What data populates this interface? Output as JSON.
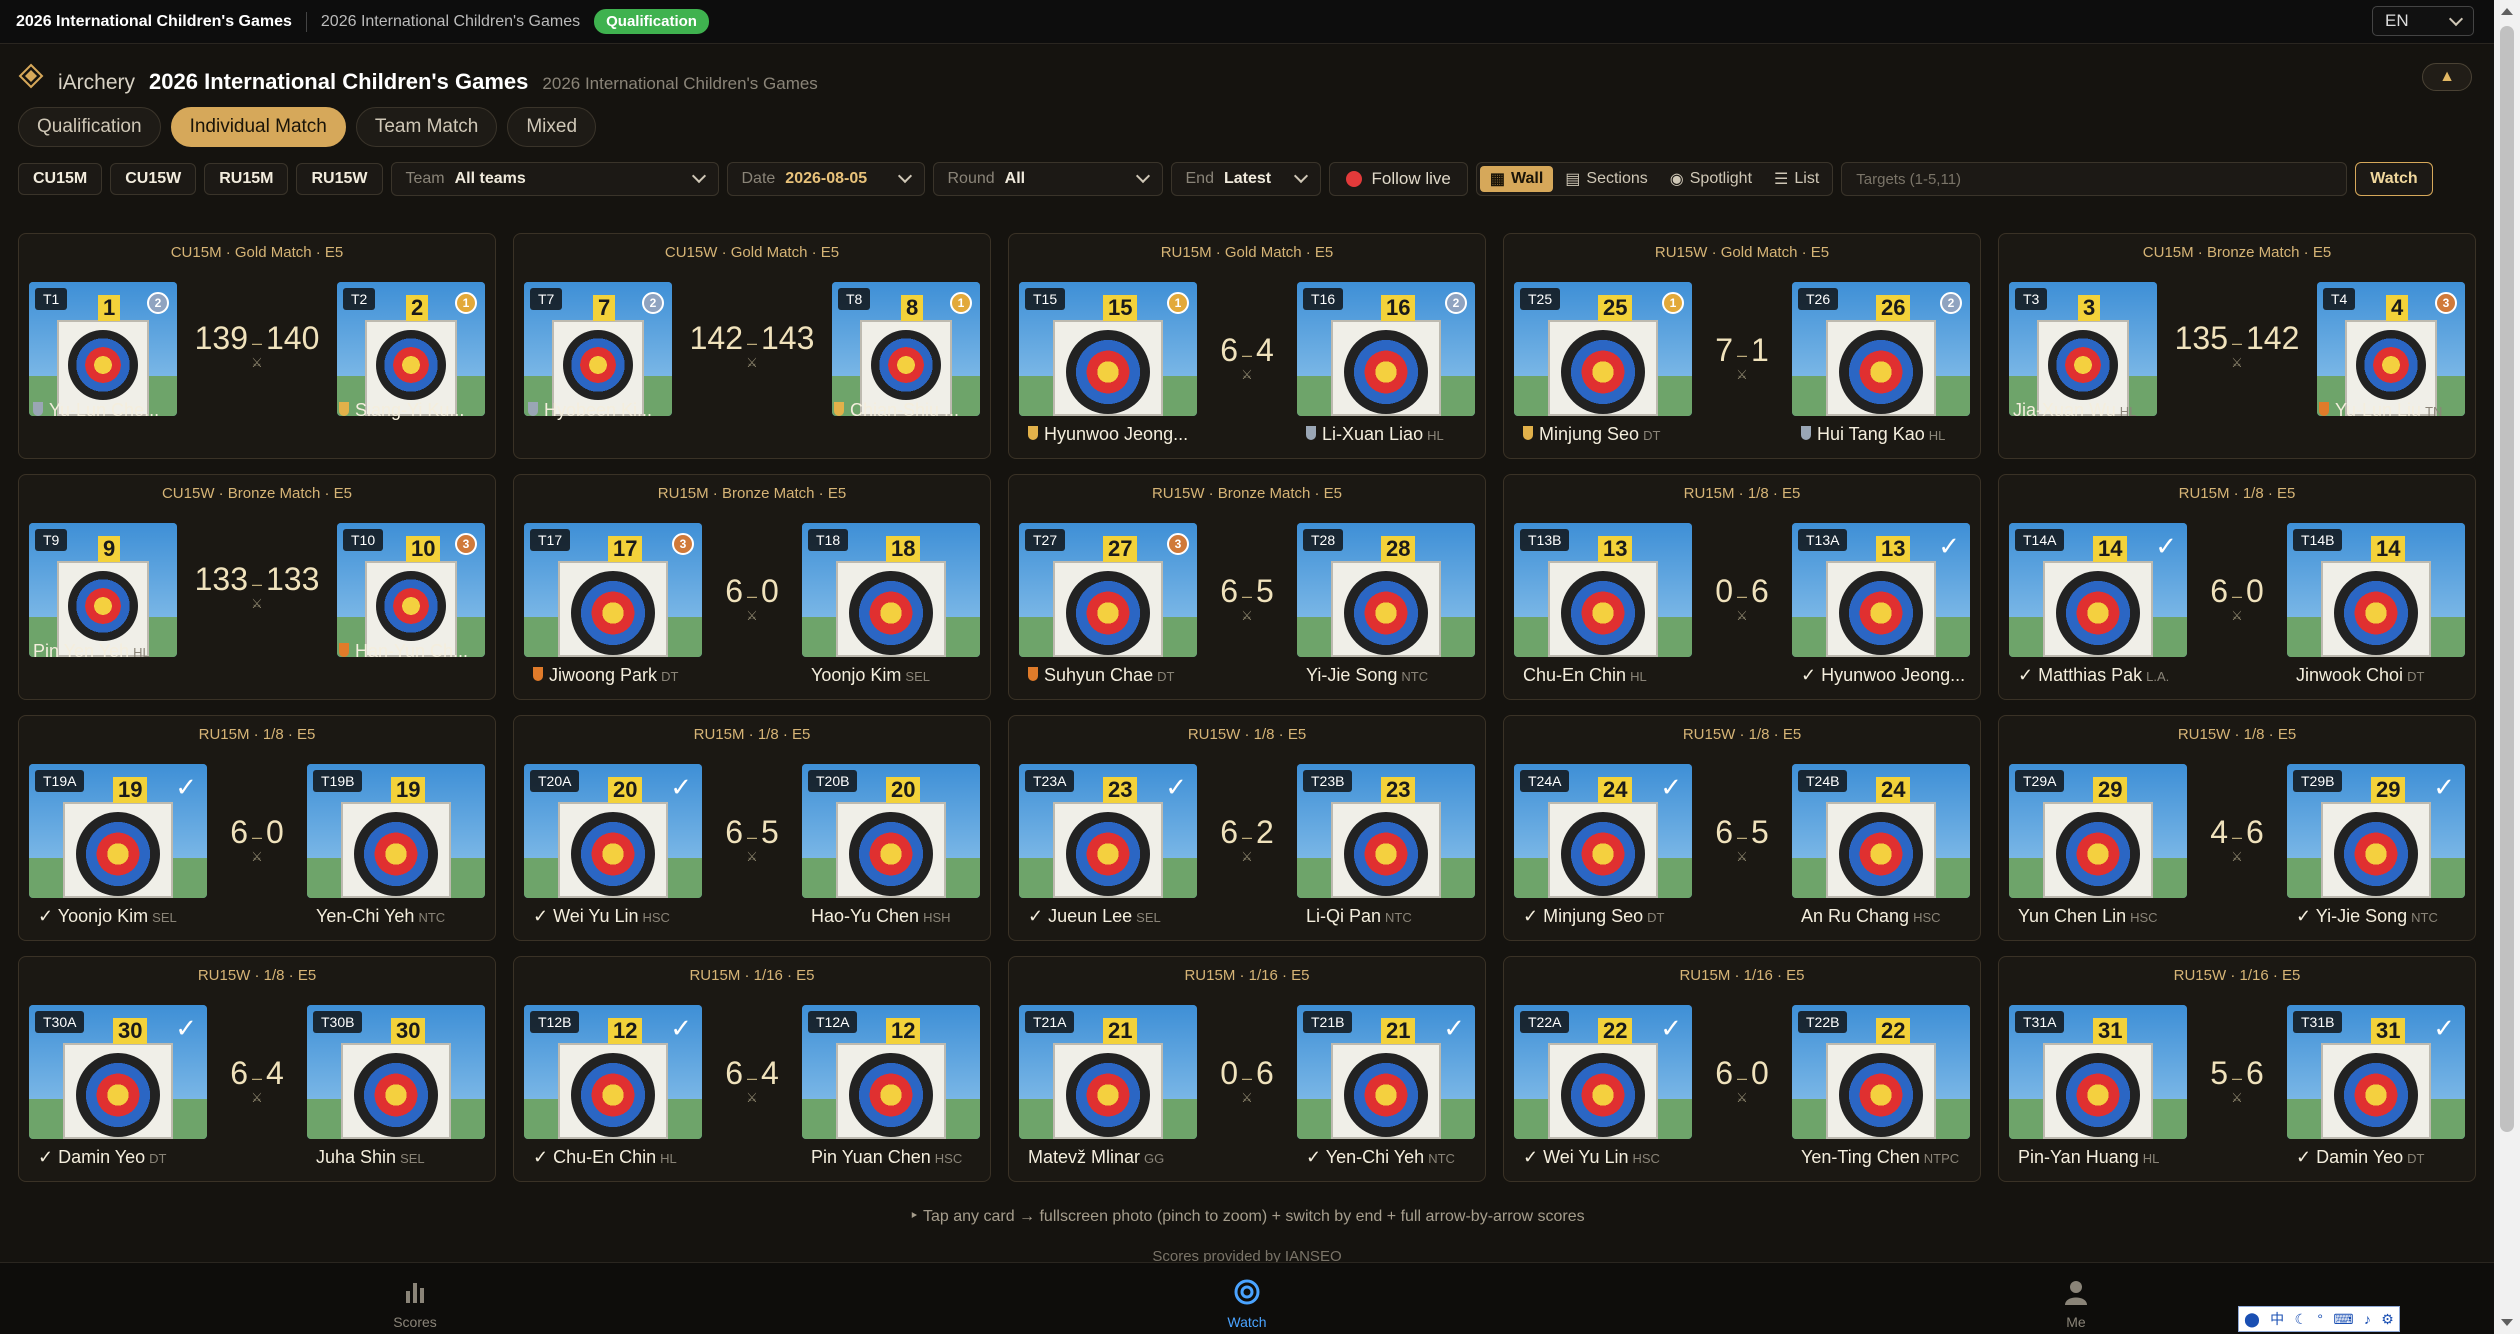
{
  "topbar": {
    "title": "2026 International Children's Games",
    "subtitle": "2026 International Children's Games",
    "badge": "Qualification",
    "language": "EN"
  },
  "header": {
    "app_name": "iArchery",
    "event": "2026 International Children's Games",
    "event_sub": "2026 International Children's Games",
    "collapse_icon": "▲"
  },
  "tabs": [
    "Qualification",
    "Individual Match",
    "Team Match",
    "Mixed"
  ],
  "active_tab": "Individual Match",
  "filters": {
    "divisions": [
      "CU15M",
      "CU15W",
      "RU15M",
      "RU15W"
    ],
    "team_label": "Team",
    "team_value": "All teams",
    "date_label": "Date",
    "date_value": "2026-08-05",
    "round_label": "Round",
    "round_value": "All",
    "end_label": "End",
    "end_value": "Latest",
    "follow_live": "Follow live",
    "views": [
      "Wall",
      "Sections",
      "Spotlight",
      "List"
    ],
    "active_view": "Wall",
    "targets_placeholder": "Targets (1-5,11)",
    "watch": "Watch"
  },
  "cards": [
    {
      "caption": "CU15M · Gold Match · E5",
      "a": {
        "tgt": "T1",
        "num": "1",
        "name": "Yu-Lun Che...",
        "club": "",
        "medal": "silver",
        "check": false
      },
      "b": {
        "tgt": "T2",
        "num": "2",
        "name": "Siang-Yi Ku...",
        "club": "",
        "medal": "gold",
        "check": false
      },
      "score_a": "139",
      "score_b": "140",
      "compound": true
    },
    {
      "caption": "CU15W · Gold Match · E5",
      "a": {
        "tgt": "T7",
        "num": "7",
        "name": "Hyobeen Ki...",
        "club": "",
        "medal": "silver",
        "check": false
      },
      "b": {
        "tgt": "T8",
        "num": "8",
        "name": "Chian-Shiu ...",
        "club": "",
        "medal": "gold",
        "check": false
      },
      "score_a": "142",
      "score_b": "143",
      "compound": true
    },
    {
      "caption": "RU15M · Gold Match · E5",
      "a": {
        "tgt": "T15",
        "num": "15",
        "name": "Hyunwoo Jeong...",
        "club": "",
        "medal": "gold",
        "check": false
      },
      "b": {
        "tgt": "T16",
        "num": "16",
        "name": "Li-Xuan Liao",
        "club": "HL",
        "medal": "silver",
        "check": false
      },
      "score_a": "6",
      "score_b": "4",
      "compound": false
    },
    {
      "caption": "RU15W · Gold Match · E5",
      "a": {
        "tgt": "T25",
        "num": "25",
        "name": "Minjung Seo",
        "club": "DT",
        "medal": "gold",
        "check": false
      },
      "b": {
        "tgt": "T26",
        "num": "26",
        "name": "Hui Tang Kao",
        "club": "HL",
        "medal": "silver",
        "check": false
      },
      "score_a": "7",
      "score_b": "1",
      "compound": false
    },
    {
      "caption": "CU15M · Bronze Match · E5",
      "a": {
        "tgt": "T3",
        "num": "3",
        "name": "Jia-Xuan Wu",
        "club": "HL",
        "medal": "",
        "check": false
      },
      "b": {
        "tgt": "T4",
        "num": "4",
        "name": "Yu-Lun Liu",
        "club": "TN",
        "medal": "bronze",
        "check": false
      },
      "score_a": "135",
      "score_b": "142",
      "compound": true
    },
    {
      "caption": "CU15W · Bronze Match · E5",
      "a": {
        "tgt": "T9",
        "num": "9",
        "name": "Pin Yen Yeh",
        "club": "HL",
        "medal": "",
        "check": false
      },
      "b": {
        "tgt": "T10",
        "num": "10",
        "name": "Han-Yun Ch...",
        "club": "",
        "medal": "bronze",
        "check": false
      },
      "score_a": "133",
      "score_b": "133",
      "compound": true
    },
    {
      "caption": "RU15M · Bronze Match · E5",
      "a": {
        "tgt": "T17",
        "num": "17",
        "name": "Jiwoong Park",
        "club": "DT",
        "medal": "bronze",
        "check": false
      },
      "b": {
        "tgt": "T18",
        "num": "18",
        "name": "Yoonjo Kim",
        "club": "SEL",
        "medal": "",
        "check": false
      },
      "score_a": "6",
      "score_b": "0",
      "compound": false
    },
    {
      "caption": "RU15W · Bronze Match · E5",
      "a": {
        "tgt": "T27",
        "num": "27",
        "name": "Suhyun Chae",
        "club": "DT",
        "medal": "bronze",
        "check": false
      },
      "b": {
        "tgt": "T28",
        "num": "28",
        "name": "Yi-Jie Song",
        "club": "NTC",
        "medal": "",
        "check": false
      },
      "score_a": "6",
      "score_b": "5",
      "compound": false
    },
    {
      "caption": "RU15M · 1/8 · E5",
      "a": {
        "tgt": "T13B",
        "num": "13",
        "name": "Chu-En Chin",
        "club": "HL",
        "medal": "",
        "check": false
      },
      "b": {
        "tgt": "T13A",
        "num": "13",
        "name": "✓ Hyunwoo Jeong...",
        "club": "",
        "medal": "",
        "check": true
      },
      "score_a": "0",
      "score_b": "6",
      "compound": false
    },
    {
      "caption": "RU15M · 1/8 · E5",
      "a": {
        "tgt": "T14A",
        "num": "14",
        "name": "✓ Matthias Pak",
        "club": "L.A.",
        "medal": "",
        "check": true
      },
      "b": {
        "tgt": "T14B",
        "num": "14",
        "name": "Jinwook Choi",
        "club": "DT",
        "medal": "",
        "check": false
      },
      "score_a": "6",
      "score_b": "0",
      "compound": false
    },
    {
      "caption": "RU15M · 1/8 · E5",
      "a": {
        "tgt": "T19A",
        "num": "19",
        "name": "✓ Yoonjo Kim",
        "club": "SEL",
        "medal": "",
        "check": true
      },
      "b": {
        "tgt": "T19B",
        "num": "19",
        "name": "Yen-Chi Yeh",
        "club": "NTC",
        "medal": "",
        "check": false
      },
      "score_a": "6",
      "score_b": "0",
      "compound": false
    },
    {
      "caption": "RU15M · 1/8 · E5",
      "a": {
        "tgt": "T20A",
        "num": "20",
        "name": "✓ Wei Yu Lin",
        "club": "HSC",
        "medal": "",
        "check": true
      },
      "b": {
        "tgt": "T20B",
        "num": "20",
        "name": "Hao-Yu Chen",
        "club": "HSH",
        "medal": "",
        "check": false
      },
      "score_a": "6",
      "score_b": "5",
      "compound": false
    },
    {
      "caption": "RU15W · 1/8 · E5",
      "a": {
        "tgt": "T23A",
        "num": "23",
        "name": "✓ Jueun Lee",
        "club": "SEL",
        "medal": "",
        "check": true
      },
      "b": {
        "tgt": "T23B",
        "num": "23",
        "name": "Li-Qi Pan",
        "club": "NTC",
        "medal": "",
        "check": false
      },
      "score_a": "6",
      "score_b": "2",
      "compound": false
    },
    {
      "caption": "RU15W · 1/8 · E5",
      "a": {
        "tgt": "T24A",
        "num": "24",
        "name": "✓ Minjung Seo",
        "club": "DT",
        "medal": "",
        "check": true
      },
      "b": {
        "tgt": "T24B",
        "num": "24",
        "name": "An Ru Chang",
        "club": "HSC",
        "medal": "",
        "check": false
      },
      "score_a": "6",
      "score_b": "5",
      "compound": false
    },
    {
      "caption": "RU15W · 1/8 · E5",
      "a": {
        "tgt": "T29A",
        "num": "29",
        "name": "Yun Chen Lin",
        "club": "HSC",
        "medal": "",
        "check": false
      },
      "b": {
        "tgt": "T29B",
        "num": "29",
        "name": "✓ Yi-Jie Song",
        "club": "NTC",
        "medal": "",
        "check": true
      },
      "score_a": "4",
      "score_b": "6",
      "compound": false
    },
    {
      "caption": "RU15W · 1/8 · E5",
      "a": {
        "tgt": "T30A",
        "num": "30",
        "name": "✓ Damin Yeo",
        "club": "DT",
        "medal": "",
        "check": true
      },
      "b": {
        "tgt": "T30B",
        "num": "30",
        "name": "Juha Shin",
        "club": "SEL",
        "medal": "",
        "check": false
      },
      "score_a": "6",
      "score_b": "4",
      "compound": false
    },
    {
      "caption": "RU15M · 1/16 · E5",
      "a": {
        "tgt": "T12B",
        "num": "12",
        "name": "✓ Chu-En Chin",
        "club": "HL",
        "medal": "",
        "check": true
      },
      "b": {
        "tgt": "T12A",
        "num": "12",
        "name": "Pin Yuan Chen",
        "club": "HSC",
        "medal": "",
        "check": false
      },
      "score_a": "6",
      "score_b": "4",
      "compound": false
    },
    {
      "caption": "RU15M · 1/16 · E5",
      "a": {
        "tgt": "T21A",
        "num": "21",
        "name": "Matevž Mlinar",
        "club": "GG",
        "medal": "",
        "check": false
      },
      "b": {
        "tgt": "T21B",
        "num": "21",
        "name": "✓ Yen-Chi Yeh",
        "club": "NTC",
        "medal": "",
        "check": true
      },
      "score_a": "0",
      "score_b": "6",
      "compound": false
    },
    {
      "caption": "RU15M · 1/16 · E5",
      "a": {
        "tgt": "T22A",
        "num": "22",
        "name": "✓ Wei Yu Lin",
        "club": "HSC",
        "medal": "",
        "check": true
      },
      "b": {
        "tgt": "T22B",
        "num": "22",
        "name": "Yen-Ting Chen",
        "club": "NTPC",
        "medal": "",
        "check": false
      },
      "score_a": "6",
      "score_b": "0",
      "compound": false
    },
    {
      "caption": "RU15W · 1/16 · E5",
      "a": {
        "tgt": "T31A",
        "num": "31",
        "name": "Pin-Yan Huang",
        "club": "HL",
        "medal": "",
        "check": false
      },
      "b": {
        "tgt": "T31B",
        "num": "31",
        "name": "✓ Damin Yeo",
        "club": "DT",
        "medal": "",
        "check": true
      },
      "score_a": "5",
      "score_b": "6",
      "compound": false
    }
  ],
  "hint": "‣ Tap any card → fullscreen photo (pinch to zoom) + switch by end + full arrow-by-arrow scores",
  "credit": "Scores provided by IANSEO",
  "bottom_nav": [
    "Scores",
    "Watch",
    "Me"
  ],
  "active_nav": "Watch"
}
